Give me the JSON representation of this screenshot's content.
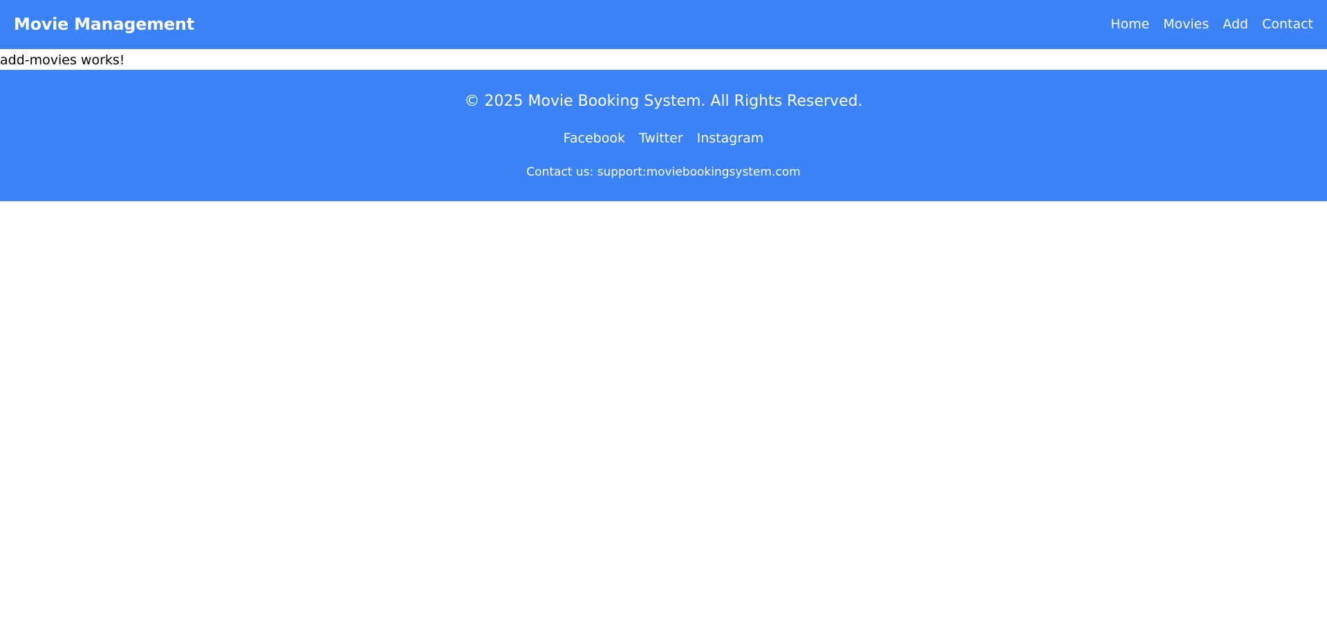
{
  "navbar": {
    "brand": "Movie Management",
    "links": [
      {
        "label": "Home"
      },
      {
        "label": "Movies"
      },
      {
        "label": "Add"
      },
      {
        "label": "Contact"
      }
    ]
  },
  "main": {
    "text": "add-movies works!"
  },
  "footer": {
    "copyright": "© 2025 Movie Booking System. All Rights Reserved.",
    "social": [
      {
        "label": "Facebook"
      },
      {
        "label": "Twitter"
      },
      {
        "label": "Instagram"
      }
    ],
    "contact": "Contact us: support:moviebookingsystem.com"
  },
  "colors": {
    "primary": "#3b82f6",
    "text_light": "#ffffff",
    "text_dark": "#000000"
  }
}
